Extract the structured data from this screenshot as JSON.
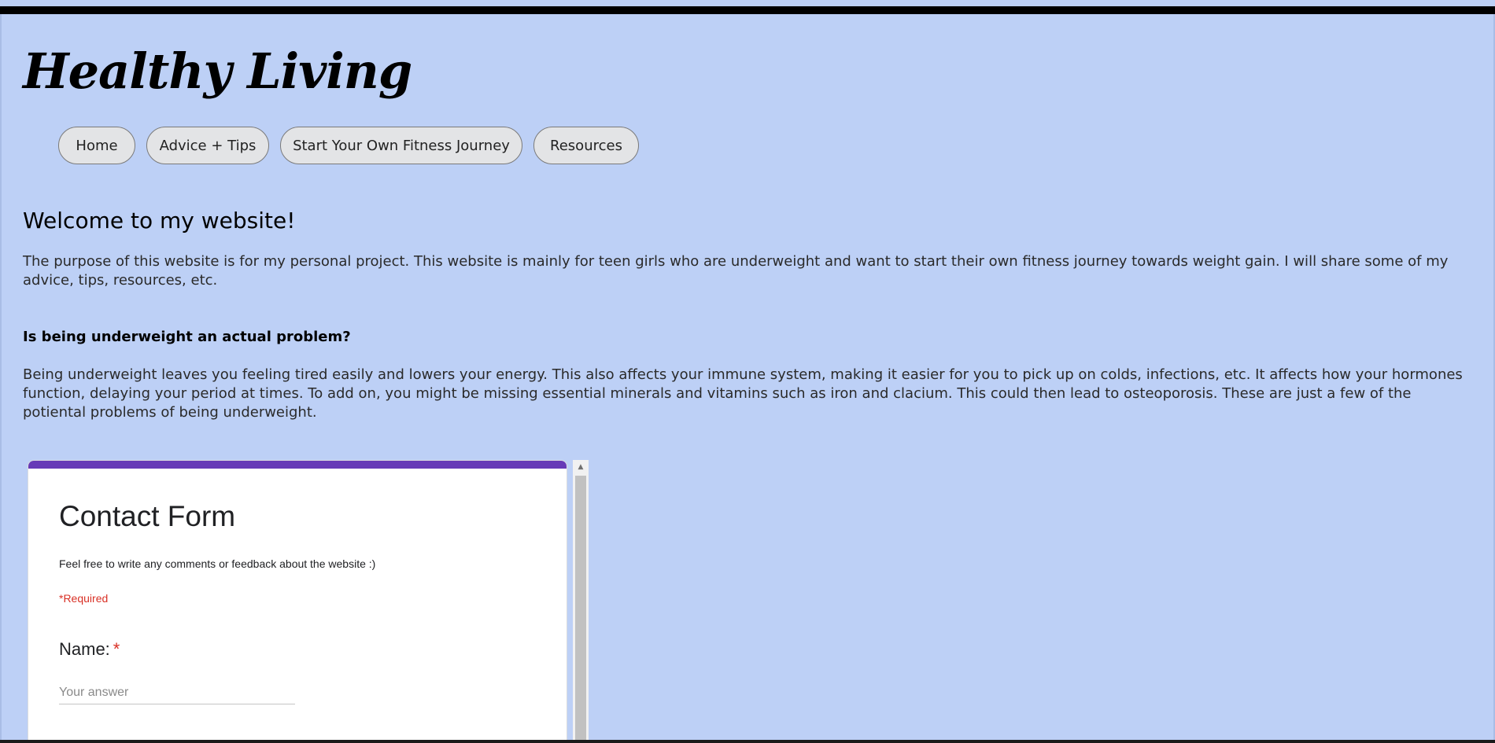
{
  "site": {
    "title": "Healthy Living"
  },
  "nav": {
    "items": [
      {
        "label": "Home"
      },
      {
        "label": "Advice + Tips"
      },
      {
        "label": "Start Your Own Fitness Journey"
      },
      {
        "label": "Resources"
      }
    ]
  },
  "main": {
    "heading": "Welcome to my website!",
    "intro": "The purpose of this website is for my personal project. This website is mainly for teen girls who are underweight and want to start their own fitness journey towards weight gain. I will share some of my advice, tips, resources, etc.",
    "subheading": "Is being underweight an actual problem?",
    "body": "Being underweight leaves you feeling tired easily and lowers your energy. This also affects your immune system, making it easier for you to pick up on colds, infections, etc. It affects how your hormones function, delaying your period at times. To add on, you might be missing essential minerals and vitamins such as iron and clacium. This could then lead to osteoporosis. These are just a few of the potiental problems of being underweight."
  },
  "form": {
    "title": "Contact Form",
    "description": "Feel free to write any comments or feedback about the website :)",
    "required_note": "*Required",
    "fields": [
      {
        "label": "Name:",
        "required_mark": "*",
        "placeholder": "Your answer"
      }
    ]
  },
  "colors": {
    "page_background": "#bdd0f6",
    "form_accent": "#673ab7",
    "required": "#d93025"
  }
}
